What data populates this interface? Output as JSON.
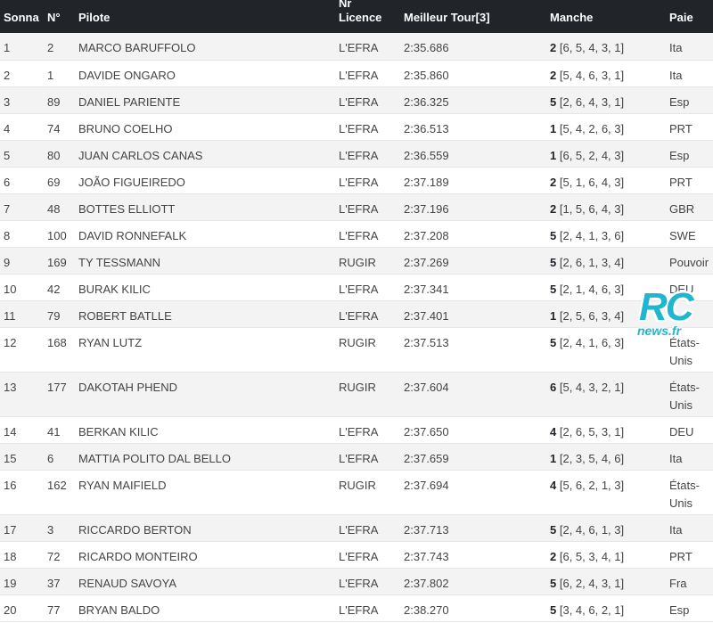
{
  "header": {
    "col_rank": "Sonna",
    "col_num": "N°",
    "col_pilot": "Pilote",
    "col_licence_top": "Nr",
    "col_licence": "Licence",
    "col_best": "Meilleur Tour[3]",
    "col_heat": "Manche",
    "col_country": "Paie"
  },
  "rows": [
    {
      "rank": "1",
      "num": "2",
      "pilot": "MARCO BARUFFOLO",
      "licence": "L'EFRA",
      "best": "2:35.686",
      "heat": "2",
      "heats": "[6, 5, 4, 3, 1]",
      "country": "Ita"
    },
    {
      "rank": "2",
      "num": "1",
      "pilot": "DAVIDE ONGARO",
      "licence": "L'EFRA",
      "best": "2:35.860",
      "heat": "2",
      "heats": "[5, 4, 6, 3, 1]",
      "country": "Ita"
    },
    {
      "rank": "3",
      "num": "89",
      "pilot": "DANIEL PARIENTE",
      "licence": "L'EFRA",
      "best": "2:36.325",
      "heat": "5",
      "heats": "[2, 6, 4, 3, 1]",
      "country": "Esp"
    },
    {
      "rank": "4",
      "num": "74",
      "pilot": "BRUNO COELHO",
      "licence": "L'EFRA",
      "best": "2:36.513",
      "heat": "1",
      "heats": "[5, 4, 2, 6, 3]",
      "country": "PRT"
    },
    {
      "rank": "5",
      "num": "80",
      "pilot": "JUAN CARLOS CANAS",
      "licence": "L'EFRA",
      "best": "2:36.559",
      "heat": "1",
      "heats": "[6, 5, 2, 4, 3]",
      "country": "Esp"
    },
    {
      "rank": "6",
      "num": "69",
      "pilot": "JOÃO FIGUEIREDO",
      "licence": "L'EFRA",
      "best": "2:37.189",
      "heat": "2",
      "heats": "[5, 1, 6, 4, 3]",
      "country": "PRT"
    },
    {
      "rank": "7",
      "num": "48",
      "pilot": "BOTTES ELLIOTT",
      "licence": "L'EFRA",
      "best": "2:37.196",
      "heat": "2",
      "heats": "[1, 5, 6, 4, 3]",
      "country": "GBR"
    },
    {
      "rank": "8",
      "num": "100",
      "pilot": "DAVID RONNEFALK",
      "licence": "L'EFRA",
      "best": "2:37.208",
      "heat": "5",
      "heats": "[2, 4, 1, 3, 6]",
      "country": "SWE"
    },
    {
      "rank": "9",
      "num": "169",
      "pilot": "TY TESSMANN",
      "licence": "RUGIR",
      "best": "2:37.269",
      "heat": "5",
      "heats": "[2, 6, 1, 3, 4]",
      "country": "Pouvoir"
    },
    {
      "rank": "10",
      "num": "42",
      "pilot": "BURAK KILIC",
      "licence": "L'EFRA",
      "best": "2:37.341",
      "heat": "5",
      "heats": "[2, 1, 4, 6, 3]",
      "country": "DEU"
    },
    {
      "rank": "11",
      "num": "79",
      "pilot": "ROBERT BATLLE",
      "licence": "L'EFRA",
      "best": "2:37.401",
      "heat": "1",
      "heats": "[2, 5, 6, 3, 4]",
      "country": "Esp"
    },
    {
      "rank": "12",
      "num": "168",
      "pilot": "RYAN LUTZ",
      "licence": "RUGIR",
      "best": "2:37.513",
      "heat": "5",
      "heats": "[2, 4, 1, 6, 3]",
      "country": "États-Unis"
    },
    {
      "rank": "13",
      "num": "177",
      "pilot": "DAKOTAH PHEND",
      "licence": "RUGIR",
      "best": "2:37.604",
      "heat": "6",
      "heats": "[5, 4, 3, 2, 1]",
      "country": "États-Unis"
    },
    {
      "rank": "14",
      "num": "41",
      "pilot": "BERKAN KILIC",
      "licence": "L'EFRA",
      "best": "2:37.650",
      "heat": "4",
      "heats": "[2, 6, 5, 3, 1]",
      "country": "DEU"
    },
    {
      "rank": "15",
      "num": "6",
      "pilot": "MATTIA POLITO DAL BELLO",
      "licence": "L'EFRA",
      "best": "2:37.659",
      "heat": "1",
      "heats": "[2, 3, 5, 4, 6]",
      "country": "Ita"
    },
    {
      "rank": "16",
      "num": "162",
      "pilot": "RYAN MAIFIELD",
      "licence": "RUGIR",
      "best": "2:37.694",
      "heat": "4",
      "heats": "[5, 6, 2, 1, 3]",
      "country": "États-Unis"
    },
    {
      "rank": "17",
      "num": "3",
      "pilot": "RICCARDO BERTON",
      "licence": "L'EFRA",
      "best": "2:37.713",
      "heat": "5",
      "heats": "[2, 4, 6, 1, 3]",
      "country": "Ita"
    },
    {
      "rank": "18",
      "num": "72",
      "pilot": "RICARDO MONTEIRO",
      "licence": "L'EFRA",
      "best": "2:37.743",
      "heat": "2",
      "heats": "[6, 5, 3, 4, 1]",
      "country": "PRT"
    },
    {
      "rank": "19",
      "num": "37",
      "pilot": "RENAUD SAVOYA",
      "licence": "L'EFRA",
      "best": "2:37.802",
      "heat": "5",
      "heats": "[6, 2, 4, 3, 1]",
      "country": "Fra"
    },
    {
      "rank": "20",
      "num": "77",
      "pilot": "BRYAN BALDO",
      "licence": "L'EFRA",
      "best": "2:38.270",
      "heat": "5",
      "heats": "[3, 4, 6, 2, 1]",
      "country": "Esp"
    }
  ],
  "watermark": {
    "brand": "RC",
    "domain": "news.fr",
    "color": "#21b6cf"
  }
}
